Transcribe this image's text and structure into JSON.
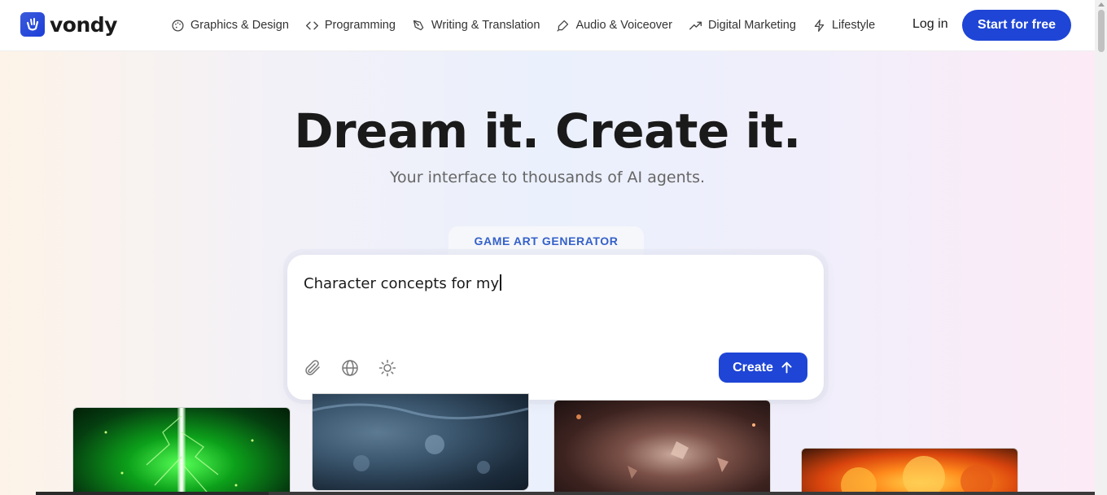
{
  "brand": {
    "name": "vondy",
    "accent": "#1e45d6"
  },
  "nav": {
    "items": [
      {
        "label": "Graphics & Design",
        "icon": "palette-icon"
      },
      {
        "label": "Programming",
        "icon": "code-icon"
      },
      {
        "label": "Writing & Translation",
        "icon": "pen-nib-icon"
      },
      {
        "label": "Audio & Voiceover",
        "icon": "microphone-icon"
      },
      {
        "label": "Digital Marketing",
        "icon": "trending-up-icon"
      },
      {
        "label": "Lifestyle",
        "icon": "lightning-icon"
      }
    ],
    "login": "Log in",
    "cta": "Start for free"
  },
  "hero": {
    "headline": "Dream it. Create it.",
    "subheadline": "Your interface to thousands of AI agents.",
    "tool_label": "GAME ART GENERATOR",
    "prompt_value": "Character concepts for my",
    "create_label": "Create",
    "tools": [
      "paperclip-icon",
      "globe-icon",
      "sun-icon"
    ]
  },
  "gallery": [
    {
      "name": "green-lightning-thumbnail"
    },
    {
      "name": "blue-water-thumbnail"
    },
    {
      "name": "explosion-debris-thumbnail"
    },
    {
      "name": "fire-cloud-thumbnail"
    }
  ]
}
